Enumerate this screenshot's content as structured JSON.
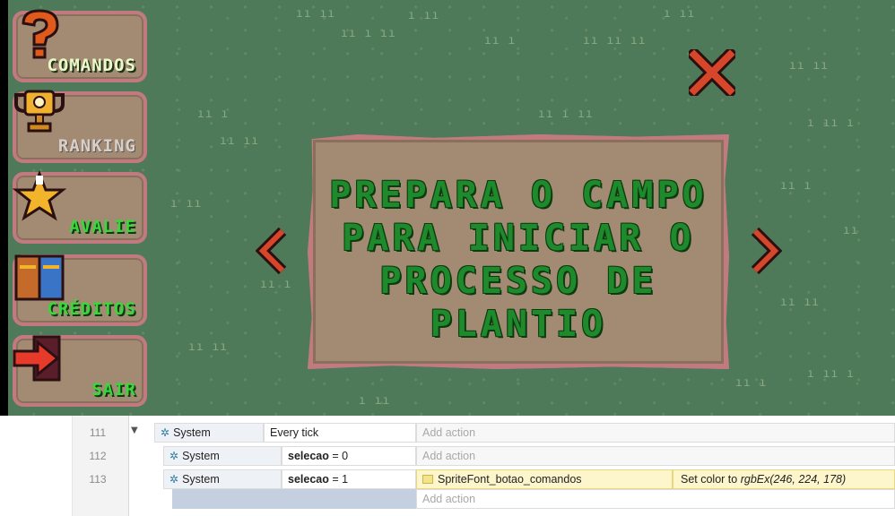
{
  "game": {
    "menu": [
      {
        "label": "COMANDOS",
        "icon": "question-mark-icon",
        "color": "#e9f9c8"
      },
      {
        "label": "RANKING",
        "icon": "trophy-icon",
        "color": "#d8d0c8"
      },
      {
        "label": "AVALIE",
        "icon": "star-icon",
        "color": "#3bd63b"
      },
      {
        "label": "CRÉDITOS",
        "icon": "books-icon",
        "color": "#3bd63b"
      },
      {
        "label": "SAIR",
        "icon": "exit-arrow-icon",
        "color": "#3bd63b"
      }
    ],
    "panel_text": "PREPARA O CAMPO PARA INICIAR O PROCESSO DE PLANTIO",
    "close_icon": "close-x-icon",
    "prev_icon": "chevron-left-icon",
    "next_icon": "chevron-right-icon",
    "colors": {
      "grass": "#4f7a5a",
      "panel": "#a38a73",
      "panel_border": "#c07a80",
      "panel_text": "#1f8a2b"
    }
  },
  "editor": {
    "rows": [
      {
        "line": "111",
        "object": "System",
        "condition": "Every tick",
        "action": "Add action"
      },
      {
        "line": "112",
        "object": "System",
        "condition_var": "selecao",
        "condition_op": " = 0",
        "action": "Add action"
      },
      {
        "line": "113",
        "object": "System",
        "condition_var": "selecao",
        "condition_op": " = 1",
        "action_object": "SpriteFont_botao_comandos",
        "action_text": "Set color to ",
        "action_value": "rgbEx(246, 224, 178)"
      },
      {
        "action": "Add action"
      }
    ],
    "expander": "▼"
  }
}
